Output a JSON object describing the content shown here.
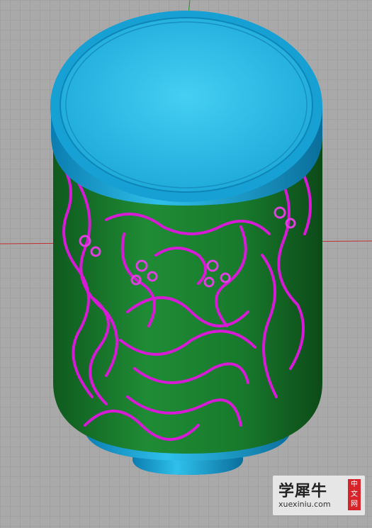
{
  "viewport": {
    "name": "3D perspective viewport",
    "background_color": "#a9a9a9",
    "grid_color": "#8f8f8f",
    "axis_x_color": "#d02020",
    "axis_y_color": "#20a020"
  },
  "model": {
    "lid_color": "#1aa3d6",
    "lid_highlight": "#3cc8ef",
    "body_color": "#187a2c",
    "relief_color": "#d61ad6",
    "base_color": "#1aa3d6"
  },
  "watermark": {
    "title": "学犀牛",
    "url": "xuexiniu.com",
    "badge": [
      "中",
      "文",
      "网"
    ],
    "badge_color": "#d6242a"
  }
}
